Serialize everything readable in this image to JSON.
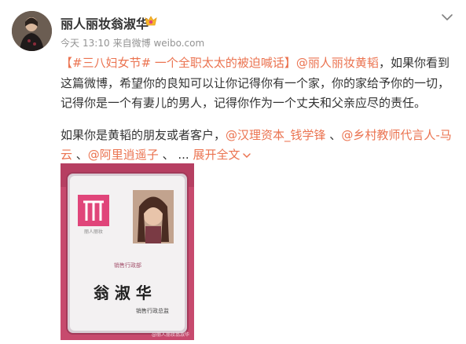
{
  "post": {
    "author": "丽人丽妆翁淑华",
    "meta": {
      "date": "今天",
      "time": "13:10",
      "source_prefix": "来自",
      "source": "微博 weibo.com"
    },
    "paragraph1": {
      "topic": "【#三八妇女节# 一个全职太太的被迫喊话】",
      "mention": "@丽人丽妆黄韬",
      "body": "，如果你看到这篇微博，希望你的良知可以让你记得你有一个家，你的家给予你的一切，记得你是一个有妻儿的男人，记得你作为一个丈夫和父亲应尽的责任。"
    },
    "paragraph2": {
      "intro": "如果你是黄韬的朋友或者客户，",
      "mention1": "@汉理资本_钱学锋",
      "sep1": " 、",
      "mention2": "@乡村教师代言人-马云",
      "sep2": " 、",
      "mention3": "@阿里逍遥子",
      "sep3": " 、 ...",
      "expand": "展开全文"
    },
    "card": {
      "logo_caption": "丽人丽妆",
      "department": "销售行政部",
      "name": "翁 淑 华",
      "title": "销售行政总监",
      "watermark": "@丽人丽妆翁淑华"
    }
  },
  "colors": {
    "link": "#eb7350",
    "text": "#333333",
    "meta": "#939393",
    "lanyard": "#c74a6e",
    "brand_pink": "#e0457a"
  },
  "icons": {
    "vip": "vip-badge-icon",
    "menu": "chevron-down-icon",
    "expand": "chevron-down-icon"
  }
}
